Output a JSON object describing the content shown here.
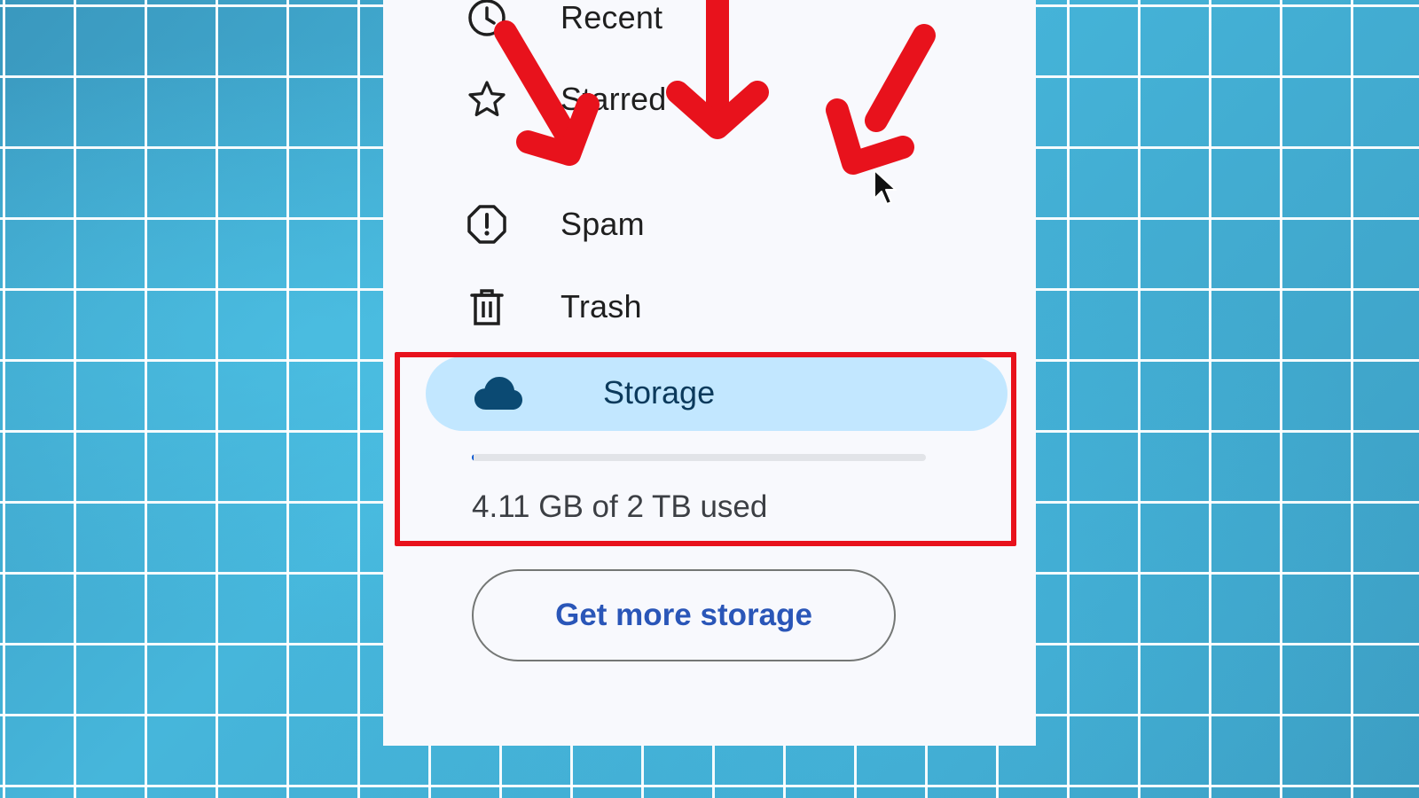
{
  "nav": {
    "items": [
      {
        "label": "Recent",
        "icon": "clock-icon"
      },
      {
        "label": "Starred",
        "icon": "star-icon"
      },
      {
        "label": "Spam",
        "icon": "alert-octagon-icon"
      },
      {
        "label": "Trash",
        "icon": "trash-icon"
      }
    ]
  },
  "storage": {
    "label": "Storage",
    "icon": "cloud-icon",
    "usage_text": "4.11 GB of 2 TB used",
    "used_fraction": 0.002,
    "button_label": "Get more storage"
  },
  "colors": {
    "accent": "#0b57d0",
    "selected_background": "#c2e7ff",
    "annotation_red": "#e8121c",
    "button_text": "#2a56b8"
  }
}
